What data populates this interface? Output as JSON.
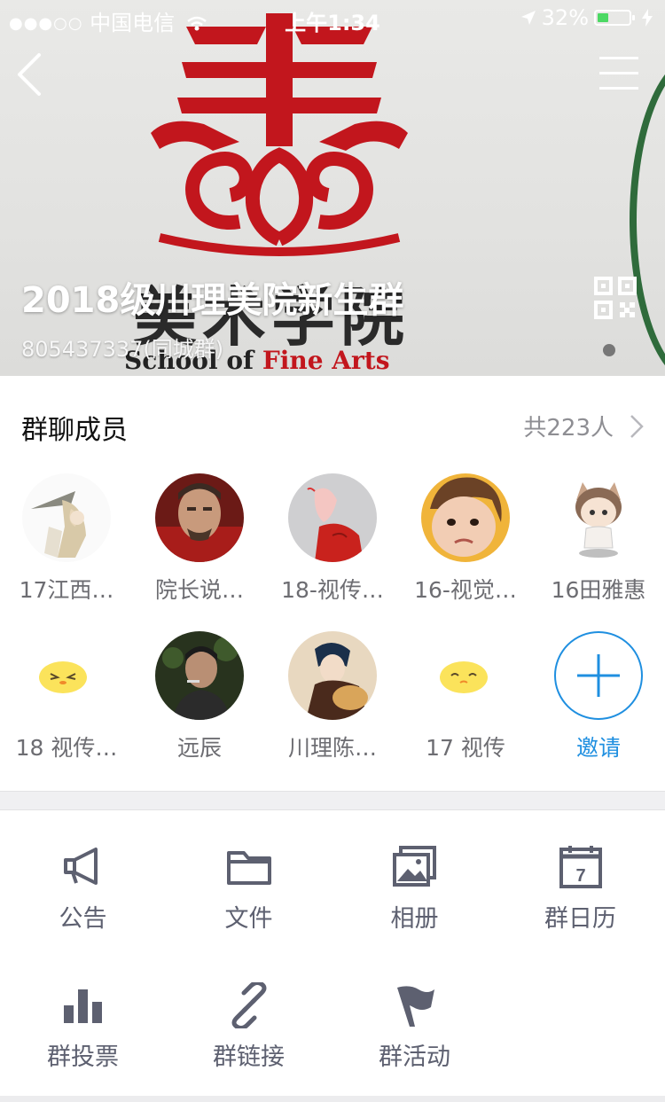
{
  "status_bar": {
    "carrier": "中国电信",
    "signal_dots": "●●●○○",
    "time": "上午1:34",
    "battery": "32%"
  },
  "header": {
    "cover_text_zh": "美术学院",
    "cover_text_en_1": "School of ",
    "cover_text_en_2": "Fine Arts",
    "group_name": "2018级川理美院新生群",
    "group_id": "805437337(同城群)"
  },
  "members": {
    "title": "群聊成员",
    "count": "共223人",
    "items": [
      {
        "name": "17江西…"
      },
      {
        "name": "院长说…"
      },
      {
        "name": "18-视传…"
      },
      {
        "name": "16-视觉…"
      },
      {
        "name": "16田雅惠"
      },
      {
        "name": "18 视传…"
      },
      {
        "name": "远辰"
      },
      {
        "name": "川理陈…"
      },
      {
        "name": "17  视传"
      }
    ],
    "invite_label": "邀请"
  },
  "features": [
    {
      "label": "公告",
      "icon": "megaphone-icon"
    },
    {
      "label": "文件",
      "icon": "folder-icon"
    },
    {
      "label": "相册",
      "icon": "album-icon"
    },
    {
      "label": "群日历",
      "icon": "calendar-icon",
      "day": "7"
    },
    {
      "label": "群投票",
      "icon": "bar-chart-icon"
    },
    {
      "label": "群链接",
      "icon": "link-icon"
    },
    {
      "label": "群活动",
      "icon": "flag-icon"
    }
  ],
  "colors": {
    "accent": "#1f8fe0",
    "icon_gray": "#5d6070",
    "logo_red": "#c2161d"
  }
}
